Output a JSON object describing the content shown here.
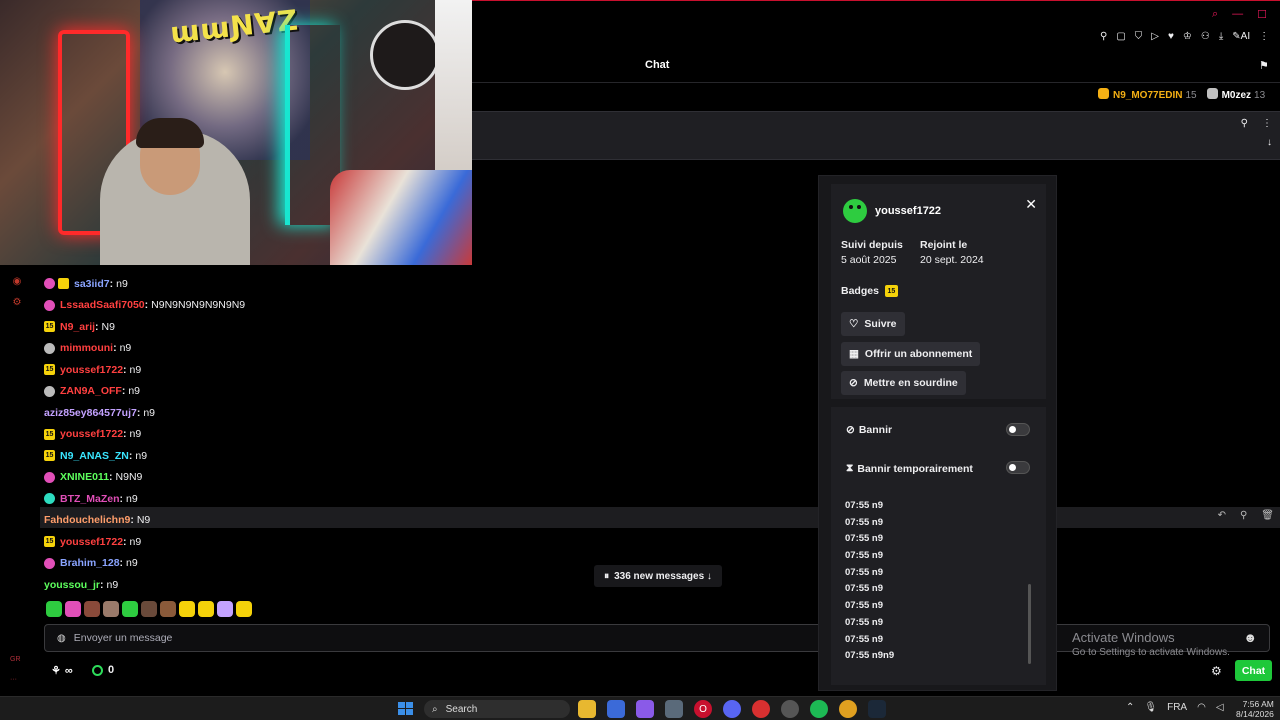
{
  "header": {
    "title": "Chat",
    "leaderboard": [
      {
        "name": "N9_MO77EDIN",
        "count": "15",
        "color": "#f5b014"
      },
      {
        "name": "M0zez",
        "count": "13",
        "color": "#c0c0c0"
      }
    ]
  },
  "messages": [
    {
      "user": "sa3iid7",
      "color": "#8aa4ff",
      "text": "n9",
      "badge": "",
      "badge_color": "#e14fb8",
      "badge2_color": "#f5d20a"
    },
    {
      "user": "LssaadSaafi7050",
      "color": "#ff4040",
      "text": "N9N9N9N9N9N9N9",
      "badge": "",
      "badge_color": "#e14fb8"
    },
    {
      "user": "N9_arij",
      "color": "#ff4040",
      "text": "N9",
      "badge": "15",
      "badge_color": "#f5d20a"
    },
    {
      "user": "mimmouni",
      "color": "#ff4040",
      "text": "n9",
      "badge": "",
      "badge_color": "#bbbbbb"
    },
    {
      "user": "youssef1722",
      "color": "#ff4040",
      "text": "n9",
      "badge": "15",
      "badge_color": "#f5d20a"
    },
    {
      "user": "ZAN9A_OFF",
      "color": "#ff4040",
      "text": "n9",
      "badge": "",
      "badge_color": "#bbbbbb"
    },
    {
      "user": "aziz85ey864577uj7",
      "color": "#c3a2ff",
      "text": "n9",
      "badge": "",
      "badge_color": ""
    },
    {
      "user": "youssef1722",
      "color": "#ff4040",
      "text": "n9",
      "badge": "15",
      "badge_color": "#f5d20a"
    },
    {
      "user": "N9_ANAS_ZN",
      "color": "#3ae6ff",
      "text": "n9",
      "badge": "15",
      "badge_color": "#f5d20a"
    },
    {
      "user": "XNINE011",
      "color": "#5dff5d",
      "text": "N9N9",
      "badge": "",
      "badge_color": "#e14fb8"
    },
    {
      "user": "BTZ_MaZen",
      "color": "#e14fb8",
      "text": "n9",
      "badge": "",
      "badge_color": "#2ddcc0"
    },
    {
      "user": "Fahdouchelichn9",
      "color": "#ff9e6b",
      "text": "N9",
      "badge": "",
      "badge_color": ""
    },
    {
      "user": "youssef1722",
      "color": "#ff4040",
      "text": "n9",
      "badge": "15",
      "badge_color": "#f5d20a"
    },
    {
      "user": "Brahim_128",
      "color": "#8aa4ff",
      "text": "n9",
      "badge": "",
      "badge_color": "#e14fb8"
    },
    {
      "user": "youssou_jr",
      "color": "#5dff5d",
      "text": "n9",
      "badge": "",
      "badge_color": ""
    }
  ],
  "emotes": [
    "#2ecc40",
    "#e14fb8",
    "#8a4a3a",
    "#9a7a6a",
    "#2ecc40",
    "#6a4a3a",
    "#8a5a3a",
    "#f5d20a",
    "#f5d20a",
    "#c3a2ff",
    "#f5d20a"
  ],
  "new_messages": "336 new messages ↓",
  "input": {
    "placeholder": "Envoyer un message"
  },
  "bottom": {
    "infinity": "∞",
    "points": "0",
    "chat_button": "Chat"
  },
  "watermark": {
    "line1": "Activate Windows",
    "line2": "Go to Settings to activate Windows."
  },
  "usercard": {
    "username": "youssef1722",
    "follow_label": "Suivi depuis",
    "follow_date": "5 août 2025",
    "joined_label": "Rejoint le",
    "joined_date": "20 sept. 2024",
    "badges_label": "Badges",
    "badge_value": "15",
    "follow_btn": "Suivre",
    "gift_btn": "Offrir un abonnement",
    "mute_btn": "Mettre en sourdine",
    "ban_label": "Bannir",
    "timeout_label": "Bannir temporairement",
    "log": [
      "07:55 n9",
      "07:55 n9",
      "07:55 n9",
      "07:55 n9",
      "07:55 n9",
      "07:55 n9",
      "07:55 n9",
      "07:55 n9",
      "07:55 n9",
      "07:55 n9n9"
    ]
  },
  "taskbar": {
    "search": "Search",
    "language": "FRA",
    "time": "7:56 AM",
    "date": "8/14/2026"
  },
  "colors": {
    "accent_green": "#1ec83a",
    "brand_red": "#c8102e"
  }
}
